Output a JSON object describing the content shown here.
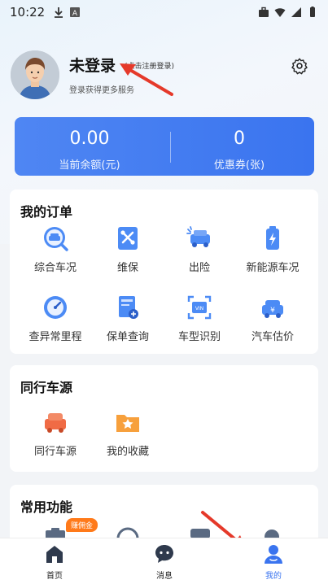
{
  "status_bar": {
    "time": "10:22"
  },
  "profile": {
    "name": "未登录",
    "hint": "(点击注册登录)",
    "subtitle": "登录获得更多服务"
  },
  "balance": {
    "amount_value": "0.00",
    "amount_label": "当前余额(元)",
    "coupon_value": "0",
    "coupon_label": "优惠券(张)"
  },
  "orders": {
    "title": "我的订单",
    "items": [
      {
        "label": "综合车况",
        "icon": "car-search-icon"
      },
      {
        "label": "维保",
        "icon": "maintenance-icon"
      },
      {
        "label": "出险",
        "icon": "accident-icon"
      },
      {
        "label": "新能源车况",
        "icon": "battery-icon"
      },
      {
        "label": "查异常里程",
        "icon": "odometer-icon"
      },
      {
        "label": "保单查询",
        "icon": "insurance-policy-icon"
      },
      {
        "label": "车型识别",
        "icon": "vin-scan-icon"
      },
      {
        "label": "汽车估价",
        "icon": "car-price-icon"
      }
    ]
  },
  "peer": {
    "title": "同行车源",
    "items": [
      {
        "label": "同行车源",
        "icon": "peer-car-icon"
      },
      {
        "label": "我的收藏",
        "icon": "favorites-folder-icon"
      }
    ]
  },
  "common": {
    "title": "常用功能",
    "badge": "赚佣金"
  },
  "nav": {
    "items": [
      {
        "label": "首页",
        "icon": "home-icon"
      },
      {
        "label": "消息",
        "icon": "message-icon"
      },
      {
        "label": "我的",
        "icon": "profile-icon"
      }
    ]
  },
  "colors": {
    "accent": "#3a74ef",
    "annotation_arrow": "#e5392a",
    "badge": "#ff7a1a"
  }
}
